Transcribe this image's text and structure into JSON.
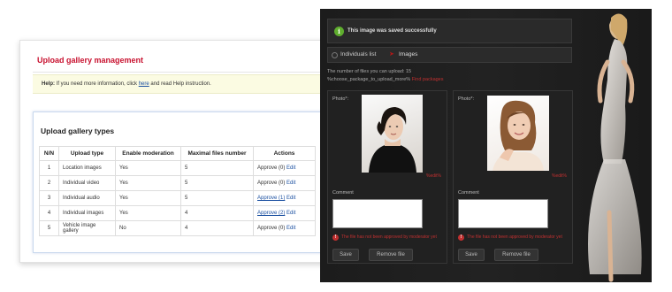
{
  "admin": {
    "title": "Upload gallery management",
    "help": {
      "label": "Help:",
      "text_before": "If you need more information, click",
      "link": "here",
      "text_after": "and read Help instruction."
    },
    "types_title": "Upload gallery types",
    "columns": [
      "N/N",
      "Upload type",
      "Enable moderation",
      "Maximal files number",
      "Actions"
    ],
    "rows": [
      {
        "n": "1",
        "type": "Location images",
        "moderation": "Yes",
        "max": "5",
        "approve": "Approve (0)",
        "approve_link": false,
        "edit": "Edit"
      },
      {
        "n": "2",
        "type": "Individual video",
        "moderation": "Yes",
        "max": "5",
        "approve": "Approve (0)",
        "approve_link": false,
        "edit": "Edit"
      },
      {
        "n": "3",
        "type": "Individual audio",
        "moderation": "Yes",
        "max": "5",
        "approve": "Approve (1)",
        "approve_link": true,
        "edit": "Edit"
      },
      {
        "n": "4",
        "type": "Individual images",
        "moderation": "Yes",
        "max": "4",
        "approve": "Approve (2)",
        "approve_link": true,
        "edit": "Edit"
      },
      {
        "n": "5",
        "type": "Vehicle image gallery",
        "moderation": "No",
        "max": "4",
        "approve": "Approve (0)",
        "approve_link": false,
        "edit": "Edit"
      }
    ]
  },
  "user": {
    "success_message": "This image was saved successfully",
    "tabs": {
      "first": "Individuals list",
      "second": "Images"
    },
    "quota_line1": "The number of files you can upload: 15",
    "quota_line2_prefix": "%choose_package_to_upload_more%",
    "quota_line2_link": "Find packages",
    "cards": [
      {
        "photo_label": "Photo*:",
        "edit": "%edit%",
        "comment_label": "Comment",
        "warning": "The file has not been approved by moderator yet",
        "save": "Save",
        "remove": "Remove file"
      },
      {
        "photo_label": "Photo*:",
        "edit": "%edit%",
        "comment_label": "Comment",
        "warning": "The file has not been approved by moderator yet",
        "save": "Save",
        "remove": "Remove file"
      }
    ]
  },
  "colors": {
    "accent_red": "#c8102e",
    "link_blue": "#1a4fa0",
    "ok_green": "#5fae2e"
  },
  "icons": {
    "success": "check-circle-icon",
    "warning": "exclamation-circle-icon",
    "tab_radio": "radio-icon",
    "breadcrumb_arrow": "arrow-right-icon"
  }
}
